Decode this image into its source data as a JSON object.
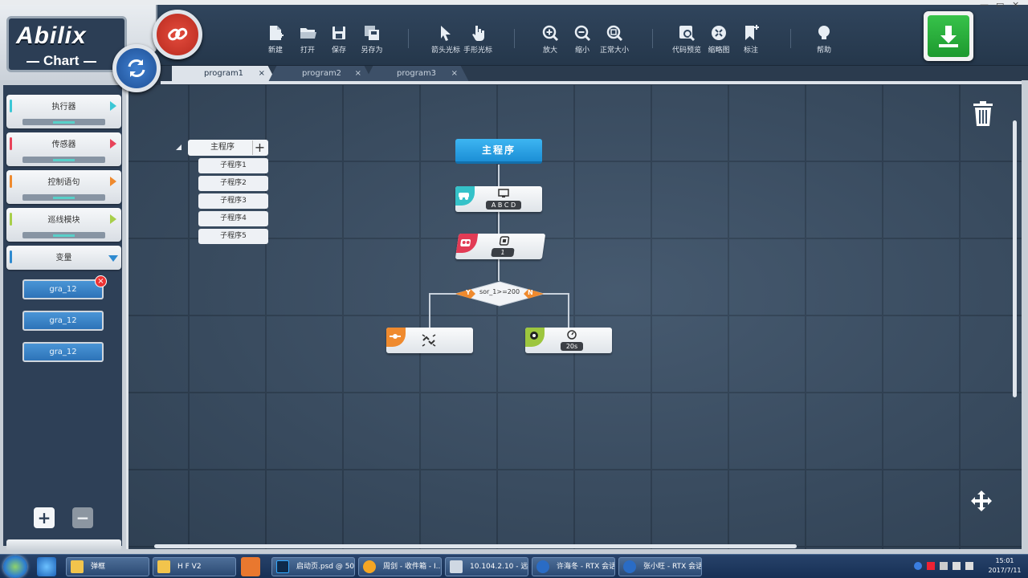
{
  "app": {
    "logo_title": "Abilix",
    "logo_sub": "Chart"
  },
  "toolbar": {
    "new": "新建",
    "open": "打开",
    "save": "保存",
    "save_as": "另存为",
    "arrow_cursor": "箭头光标",
    "hand_cursor": "手形光标",
    "zoom_in": "放大",
    "zoom_out": "缩小",
    "actual_size": "正常大小",
    "code_preview": "代码预览",
    "thumbnail": "缩略图",
    "annotate": "标注",
    "help": "帮助"
  },
  "tabs": [
    {
      "label": "program1",
      "close": "×"
    },
    {
      "label": "program2",
      "close": "×"
    },
    {
      "label": "program3",
      "close": "×"
    }
  ],
  "sidebar": {
    "categories": [
      {
        "label": "执行器",
        "color": "#3bc7d6"
      },
      {
        "label": "传感器",
        "color": "#e8435a"
      },
      {
        "label": "控制语句",
        "color": "#ef8a2e"
      },
      {
        "label": "巡线模块",
        "color": "#a8cf4a"
      },
      {
        "label": "变量",
        "color": "#2e8ad0"
      }
    ],
    "variables": [
      "gra_12",
      "gra_12",
      "gra_12"
    ],
    "delete_badge": "×",
    "add_label": "+",
    "remove_label": "−"
  },
  "program_tree": {
    "main": "主程序",
    "add": "+",
    "subs": [
      "子程序1",
      "子程序2",
      "子程序3",
      "子程序4",
      "子程序5"
    ]
  },
  "flow": {
    "start": "主程序",
    "display_value": "A B C D",
    "sensor_value": "1",
    "condition": "sor_1>=200",
    "yes": "Y",
    "no": "N",
    "timer_value": "20s"
  },
  "taskbar": {
    "items": [
      "弹框",
      "H F  V2",
      "启动页.psd @ 50...",
      "周剑 - 收件箱 - I...",
      "10.104.2.10 - 远...",
      "许海冬 - RTX 会话",
      "张小旺 - RTX 会话"
    ],
    "time": "15:01",
    "date": "2017/7/11"
  }
}
